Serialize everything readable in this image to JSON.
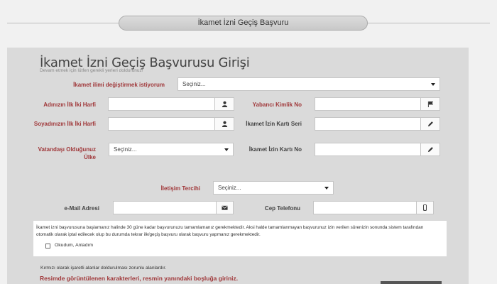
{
  "header": {
    "title": "İkamet İzni Geçiş Başvuru"
  },
  "form": {
    "title": "İkamet İzni Geçiş Başvurusu Girişi",
    "subtitle": "Devam etmek için lütfen gerekli yerleri doldurunuz!",
    "residence_change": {
      "label": "İkamet ilimi değiştirmek istiyorum",
      "value": "Seçiniz..."
    },
    "father_initials": {
      "label": "Adınızın İlk İki Harfi",
      "value": "",
      "icon": "user-icon"
    },
    "foreigner_id": {
      "label": "Yabancı Kimlik No",
      "value": "",
      "icon": "flag-icon"
    },
    "surname_initials": {
      "label": "Soyadınızın İlk İki Harfi",
      "value": "",
      "icon": "user-icon"
    },
    "permit_series": {
      "label": "İkamet İzin Kartı Seri",
      "value": "",
      "icon": "pencil-icon"
    },
    "nationality": {
      "label": "Vatandaşı Olduğunuz Ülke",
      "value": "Seçiniz..."
    },
    "permit_no": {
      "label": "İkamet İzin Kartı No",
      "value": "",
      "icon": "pencil-icon"
    },
    "contact_pref": {
      "label": "İletişim Tercihi",
      "value": "Seçiniz..."
    },
    "email": {
      "label": "e-Mail Adresi",
      "value": "",
      "icon": "envelope-icon"
    },
    "mobile": {
      "label": "Cep Telefonu",
      "value": "",
      "icon": "mobile-phone-icon"
    }
  },
  "info": {
    "text": "İkamet izni başvurusuna başlamanız halinde 30 güne kadar başvurunuzu tamamlamanız gerekmektedir. Aksi halde tamamlanmayan başvurunuz izin verilen sürenizin sonunda sistem tarafından otomatik olarak iptal edilecek olup bu durumda tekrar ilk/geçiş başvuru olarak başvuru yapmanız gerekmektedir.",
    "checkbox_label": "Okudum, Anladım",
    "checked": false
  },
  "footer": {
    "required_note": "Kırmızı olarak işaretli alanlar doldurulması zorunlu alanlardır.",
    "captcha_instruction": "Resimde görüntülenen karakterleri, resmin yanındaki boşluğa giriniz."
  },
  "colors": {
    "label_red": "#a0383a",
    "panel": "#dadada",
    "background": "#f1f1f1"
  }
}
